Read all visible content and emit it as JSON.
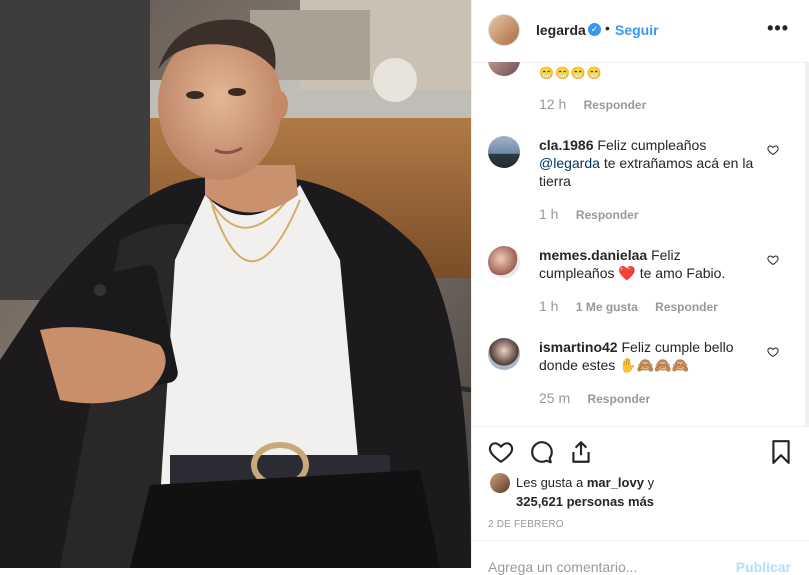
{
  "post": {
    "username": "legarda",
    "follow_label": "Seguir",
    "separator": "•",
    "more_label": "•••"
  },
  "comments": [
    {
      "emoji": "😁😁😁😁",
      "time": "12 h",
      "reply": "Responder"
    },
    {
      "user": "cla.1986",
      "text_before": "Feliz cumpleaños",
      "mention": "@legarda",
      "text_after": "te extrañamos acá en la tierra",
      "time": "1 h",
      "reply": "Responder"
    },
    {
      "user": "memes.danielaa",
      "text_before": "Feliz cumpleaños",
      "heart": "❤️",
      "text_after": "te amo Fabio.",
      "time": "1 h",
      "likes": "1 Me gusta",
      "reply": "Responder"
    },
    {
      "user": "ismartino42",
      "text": "Feliz cumple bello donde estes ✋🙈🙈🙈",
      "time": "25 m",
      "reply": "Responder"
    }
  ],
  "likes": {
    "prefix": "Les gusta a",
    "first_user": "mar_lovy",
    "connector": "y",
    "count_text": "325,621 personas más"
  },
  "date": "2 DE FEBRERO",
  "add_comment": {
    "placeholder": "Agrega un comentario...",
    "publish": "Publicar"
  },
  "icons": [
    "heart-icon",
    "comment-icon",
    "share-icon",
    "bookmark-icon",
    "verified-badge-icon"
  ],
  "colors": {
    "link": "#3897f0",
    "heart": "#ed4956",
    "muted": "#999999"
  }
}
